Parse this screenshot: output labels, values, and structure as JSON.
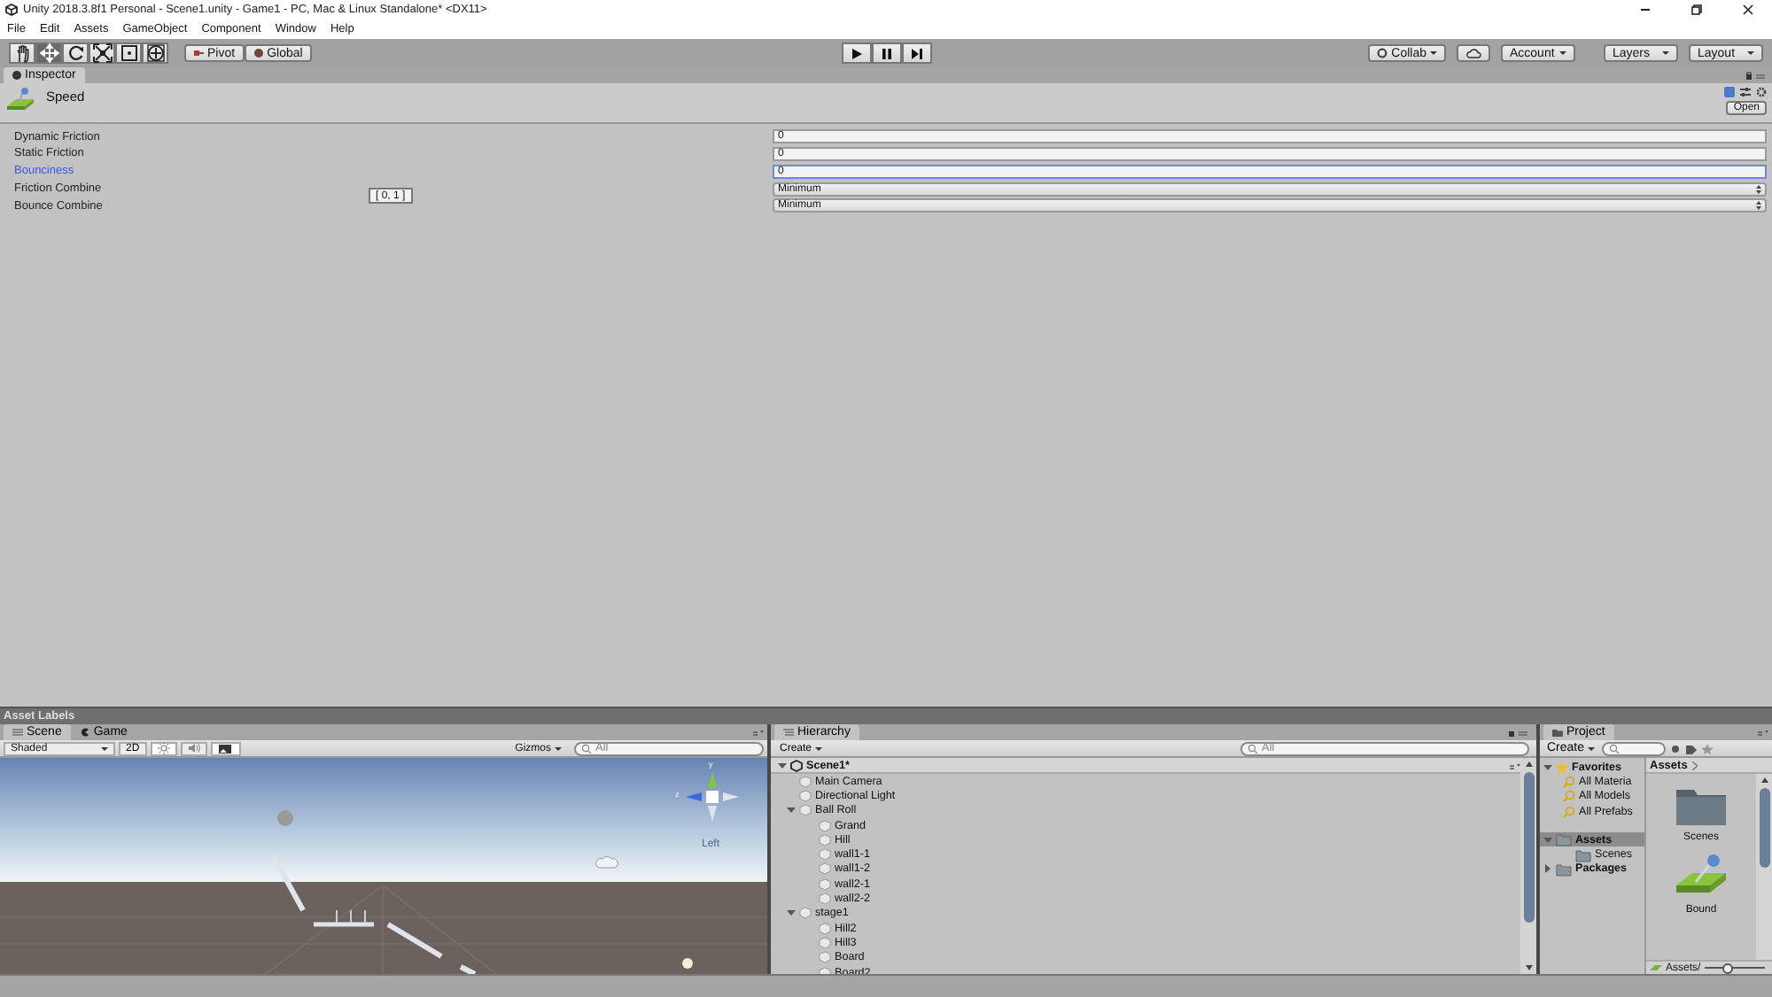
{
  "window": {
    "title": "Unity 2018.3.8f1 Personal - Scene1.unity - Game1 - PC, Mac & Linux Standalone* <DX11>"
  },
  "menu": [
    "File",
    "Edit",
    "Assets",
    "GameObject",
    "Component",
    "Window",
    "Help"
  ],
  "toolbar": {
    "tools": [
      {
        "kind": "hand",
        "selected": false
      },
      {
        "kind": "move",
        "selected": true
      },
      {
        "kind": "rotate",
        "selected": false
      },
      {
        "kind": "scale",
        "selected": false
      },
      {
        "kind": "rect",
        "selected": false
      },
      {
        "kind": "transform",
        "selected": false
      }
    ],
    "pivot": "Pivot",
    "global": "Global",
    "collab": "Collab",
    "account": "Account",
    "layers": "Layers",
    "layout": "Layout"
  },
  "inspector": {
    "tab": "Inspector",
    "asset_name": "Speed",
    "open_button": "Open",
    "tooltip": "[ 0, 1 ]",
    "properties": [
      {
        "label": "Dynamic Friction",
        "kind": "number",
        "value": "0",
        "focused": false
      },
      {
        "label": "Static Friction",
        "kind": "number",
        "value": "0",
        "focused": false
      },
      {
        "label": "Bounciness",
        "kind": "number",
        "value": "0",
        "focused": true
      },
      {
        "label": "Friction Combine",
        "kind": "dropdown",
        "value": "Minimum",
        "focused": false
      },
      {
        "label": "Bounce Combine",
        "kind": "dropdown",
        "value": "Minimum",
        "focused": false
      }
    ]
  },
  "asset_labels": "Asset Labels",
  "scene": {
    "tabs": [
      {
        "label": "Scene",
        "selected": true
      },
      {
        "label": "Game",
        "selected": false
      }
    ],
    "shading": "Shaded",
    "mode_2d": "2D",
    "gizmos": "Gizmos",
    "search_placeholder": "All",
    "axis_labels": [
      "y",
      "z"
    ],
    "view_label": "Left"
  },
  "hierarchy": {
    "tab": "Hierarchy",
    "create": "Create",
    "search_placeholder": "All",
    "scene": "Scene1*",
    "items": [
      {
        "label": "Main Camera"
      },
      {
        "label": "Directional Light"
      },
      {
        "label": "Ball Roll",
        "expanded": true,
        "children": [
          {
            "label": "Grand"
          },
          {
            "label": "Hill"
          },
          {
            "label": "wall1-1"
          },
          {
            "label": "wall1-2"
          },
          {
            "label": "wall2-1"
          },
          {
            "label": "wall2-2"
          }
        ]
      },
      {
        "label": "stage1",
        "expanded": true,
        "children": [
          {
            "label": "Hill2"
          },
          {
            "label": "Hill3"
          },
          {
            "label": "Board"
          },
          {
            "label": "Board2"
          }
        ]
      }
    ]
  },
  "project": {
    "tab": "Project",
    "create": "Create",
    "favorites": "Favorites",
    "favorite_items": [
      "All Materia",
      "All Models",
      "All Prefabs"
    ],
    "tree": [
      {
        "label": "Assets",
        "selected": true,
        "expanded": true,
        "children": [
          {
            "label": "Scenes",
            "selected": false
          }
        ]
      },
      {
        "label": "Packages",
        "selected": false,
        "expanded": false
      }
    ],
    "breadcrumb": "Assets",
    "assets": [
      {
        "name": "Scenes",
        "kind": "folder"
      },
      {
        "name": "Bound",
        "kind": "material"
      }
    ],
    "footer_path": "Assets/",
    "zoom": {
      "level": 0.4
    }
  }
}
